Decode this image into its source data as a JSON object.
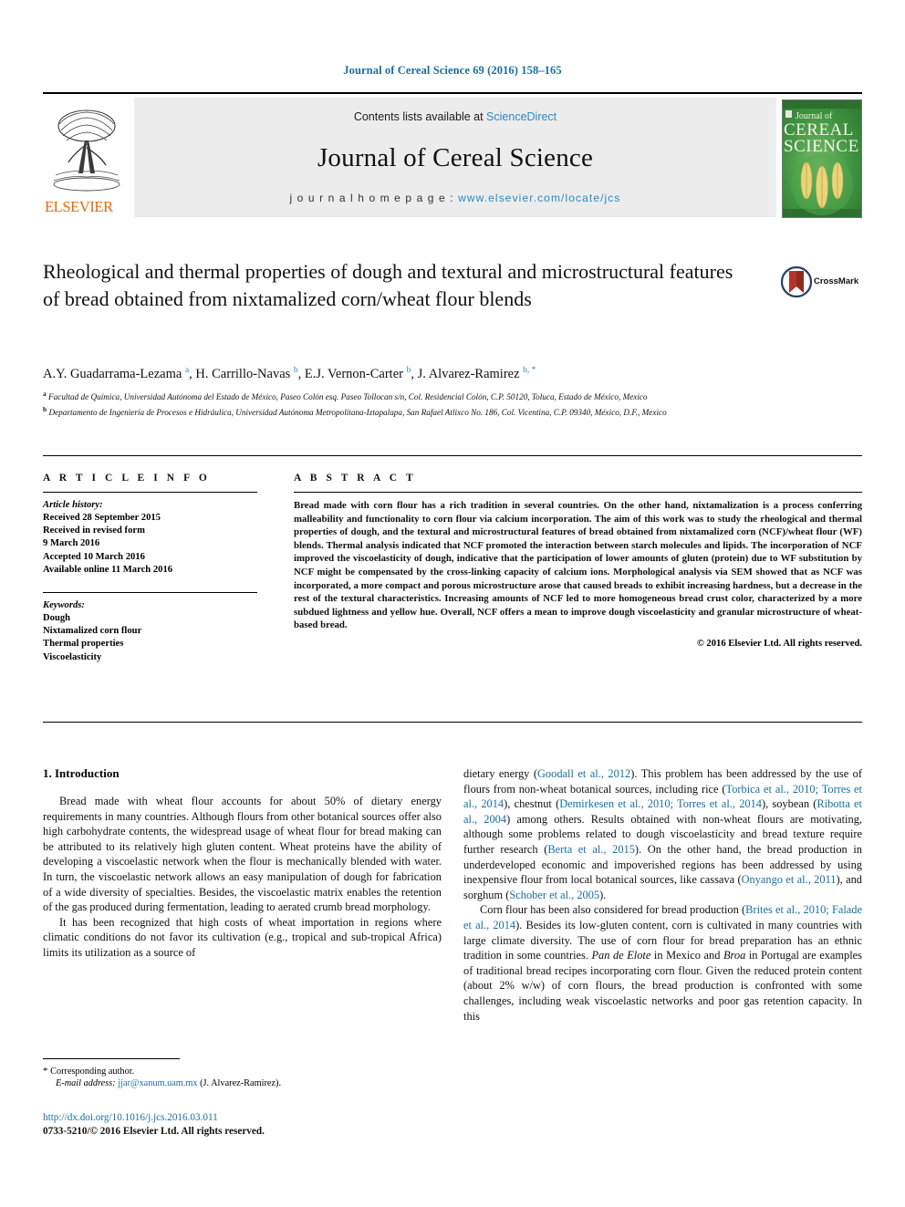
{
  "running_head": "Journal of Cereal Science 69 (2016) 158–165",
  "masthead": {
    "contents_prefix": "Contents lists available at ",
    "sciencedirect": "ScienceDirect",
    "journal_name": "Journal of Cereal Science",
    "homepage_prefix": "j o u r n a l   h o m e p a g e :   ",
    "homepage_url": "www.elsevier.com/locate/jcs",
    "publisher": "ELSEVIER",
    "cover_line1": "Journal of",
    "cover_line2": "CEREAL",
    "cover_line3": "SCIENCE"
  },
  "title": "Rheological and thermal properties of dough and textural and microstructural features of bread obtained from nixtamalized corn/wheat flour blends",
  "crossmark_label": "CrossMark",
  "authors_html": "A.Y. Guadarrama-Lezama <sup>a</sup>, H. Carrillo-Navas <sup>b</sup>, E.J. Vernon-Carter <sup>b</sup>, J. Alvarez-Ramirez <sup>b, <span class=\"star\">*</span></sup>",
  "affiliations": [
    "Facultad de Química, Universidad Autónoma del Estado de México, Paseo Colón esq. Paseo Tollocan s/n, Col. Residencial Colón, C.P. 50120, Toluca, Estado de México, Mexico",
    "Departamento de Ingeniería de Procesos e Hidráulica, Universidad Autónoma Metropolitana-Iztapalapa, San Rafael Atlixco No. 186, Col. Vicentina, C.P. 09340, México, D.F., Mexico"
  ],
  "affiliation_markers": [
    "a",
    "b"
  ],
  "article_info": {
    "heading": "A R T I C L E  I N F O",
    "history_label": "Article history:",
    "history_lines": [
      "Received 28 September 2015",
      "Received in revised form",
      "9 March 2016",
      "Accepted 10 March 2016",
      "Available online 11 March 2016"
    ],
    "keywords_label": "Keywords:",
    "keywords": [
      "Dough",
      "Nixtamalized corn flour",
      "Thermal properties",
      "Viscoelasticity"
    ]
  },
  "abstract": {
    "heading": "A B S T R A C T",
    "text": "Bread made with corn flour has a rich tradition in several countries. On the other hand, nixtamalization is a process conferring malleability and functionality to corn flour via calcium incorporation. The aim of this work was to study the rheological and thermal properties of dough, and the textural and microstructural features of bread obtained from nixtamalized corn (NCF)/wheat flour (WF) blends. Thermal analysis indicated that NCF promoted the interaction between starch molecules and lipids. The incorporation of NCF improved the viscoelasticity of dough, indicative that the participation of lower amounts of gluten (protein) due to WF substitution by NCF might be compensated by the cross-linking capacity of calcium ions. Morphological analysis via SEM showed that as NCF was incorporated, a more compact and porous microstructure arose that caused breads to exhibit increasing hardness, but a decrease in the rest of the textural characteristics. Increasing amounts of NCF led to more homogeneous bread crust color, characterized by a more subdued lightness and yellow hue. Overall, NCF offers a mean to improve dough viscoelasticity and granular microstructure of wheat-based bread.",
    "copyright": "© 2016 Elsevier Ltd. All rights reserved."
  },
  "body": {
    "section_number_title": "1. Introduction",
    "left_paragraphs": [
      "Bread made with wheat flour accounts for about 50% of dietary energy requirements in many countries. Although flours from other botanical sources offer also high carbohydrate contents, the widespread usage of wheat flour for bread making can be attributed to its relatively high gluten content. Wheat proteins have the ability of developing a viscoelastic network when the flour is mechanically blended with water. In turn, the viscoelastic network allows an easy manipulation of dough for fabrication of a wide diversity of specialties. Besides, the viscoelastic matrix enables the retention of the gas produced during fermentation, leading to aerated crumb bread morphology.",
      "It has been recognized that high costs of wheat importation in regions where climatic conditions do not favor its cultivation (e.g., tropical and sub-tropical Africa) limits its utilization as a source of"
    ],
    "right_paragraph_1_html": "dietary energy (<span class=\"cit\">Goodall et al., 2012</span>). This problem has been addressed by the use of flours from non-wheat botanical sources, including rice (<span class=\"cit\">Torbica et al., 2010; Torres et al., 2014</span>), chestnut (<span class=\"cit\">Demirkesen et al., 2010; Torres et al., 2014</span>), soybean (<span class=\"cit\">Ribotta et al., 2004</span>) among others. Results obtained with non-wheat flours are motivating, although some problems related to dough viscoelasticity and bread texture require further research (<span class=\"cit\">Berta et al., 2015</span>). On the other hand, the bread production in underdeveloped economic and impoverished regions has been addressed by using inexpensive flour from local botanical sources, like cassava (<span class=\"cit\">Onyango et al., 2011</span>), and sorghum (<span class=\"cit\">Schober et al., 2005</span>).",
    "right_paragraph_2_html": "Corn flour has been also considered for bread production (<span class=\"cit\">Brites et al., 2010; Falade et al., 2014</span>). Besides its low-gluten content, corn is cultivated in many countries with large climate diversity. The use of corn flour for bread preparation has an ethnic tradition in some countries. <span class=\"ital\">Pan de Elote</span> in Mexico and <span class=\"ital\">Broa</span> in Portugal are examples of traditional bread recipes incorporating corn flour. Given the reduced protein content (about 2% w/w) of corn flours, the bread production is confronted with some challenges, including weak viscoelastic networks and poor gas retention capacity. In this"
  },
  "footnote": {
    "star": "*",
    "corresponding": "Corresponding author.",
    "email_label": "E-mail address:",
    "email": "jjar@xanum.uam.mx",
    "email_owner": "(J. Alvarez-Ramirez)."
  },
  "doi": "http://dx.doi.org/10.1016/j.jcs.2016.03.011",
  "issn_line": "0733-5210/© 2016 Elsevier Ltd. All rights reserved.",
  "colors": {
    "link_blue": "#1a6ea5",
    "sciencedirect_blue": "#2a8bc4",
    "elsevier_orange": "#ec6707",
    "band_gray": "#ececec",
    "cover_green": "#3c8f3c"
  }
}
